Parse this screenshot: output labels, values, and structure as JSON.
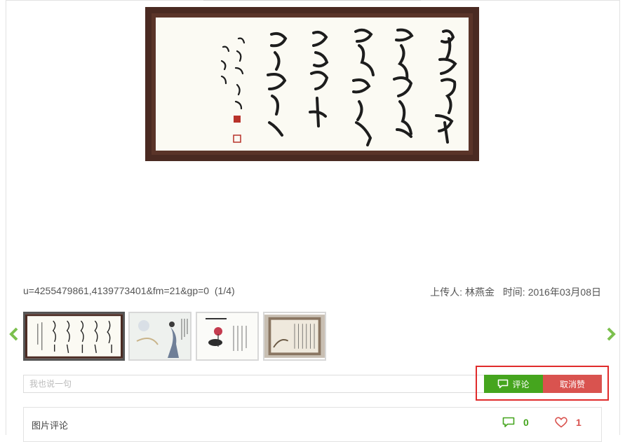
{
  "image": {
    "alt": "calligraphy artwork",
    "caption": "u=4255479861,4139773401&fm=21&gp=0",
    "position": "(1/4)"
  },
  "meta": {
    "uploader_label": "上传人:",
    "uploader_name": "林燕金",
    "time_label": "时间:",
    "time_value": "2016年03月08日"
  },
  "thumbnails": [
    {
      "name": "thumb-calligraphy",
      "active": true
    },
    {
      "name": "thumb-figure-painting",
      "active": false
    },
    {
      "name": "thumb-lotus-poem",
      "active": false
    },
    {
      "name": "thumb-framed-scroll",
      "active": false
    }
  ],
  "comment_box": {
    "placeholder": "我也说一句",
    "comment_button": "评论",
    "unlike_button": "取消赞"
  },
  "comments_section": {
    "title": "图片评论",
    "comment_count": "0",
    "like_count": "1"
  },
  "colors": {
    "green": "#45a51e",
    "red": "#d9534f",
    "highlight": "#e02b2b"
  }
}
